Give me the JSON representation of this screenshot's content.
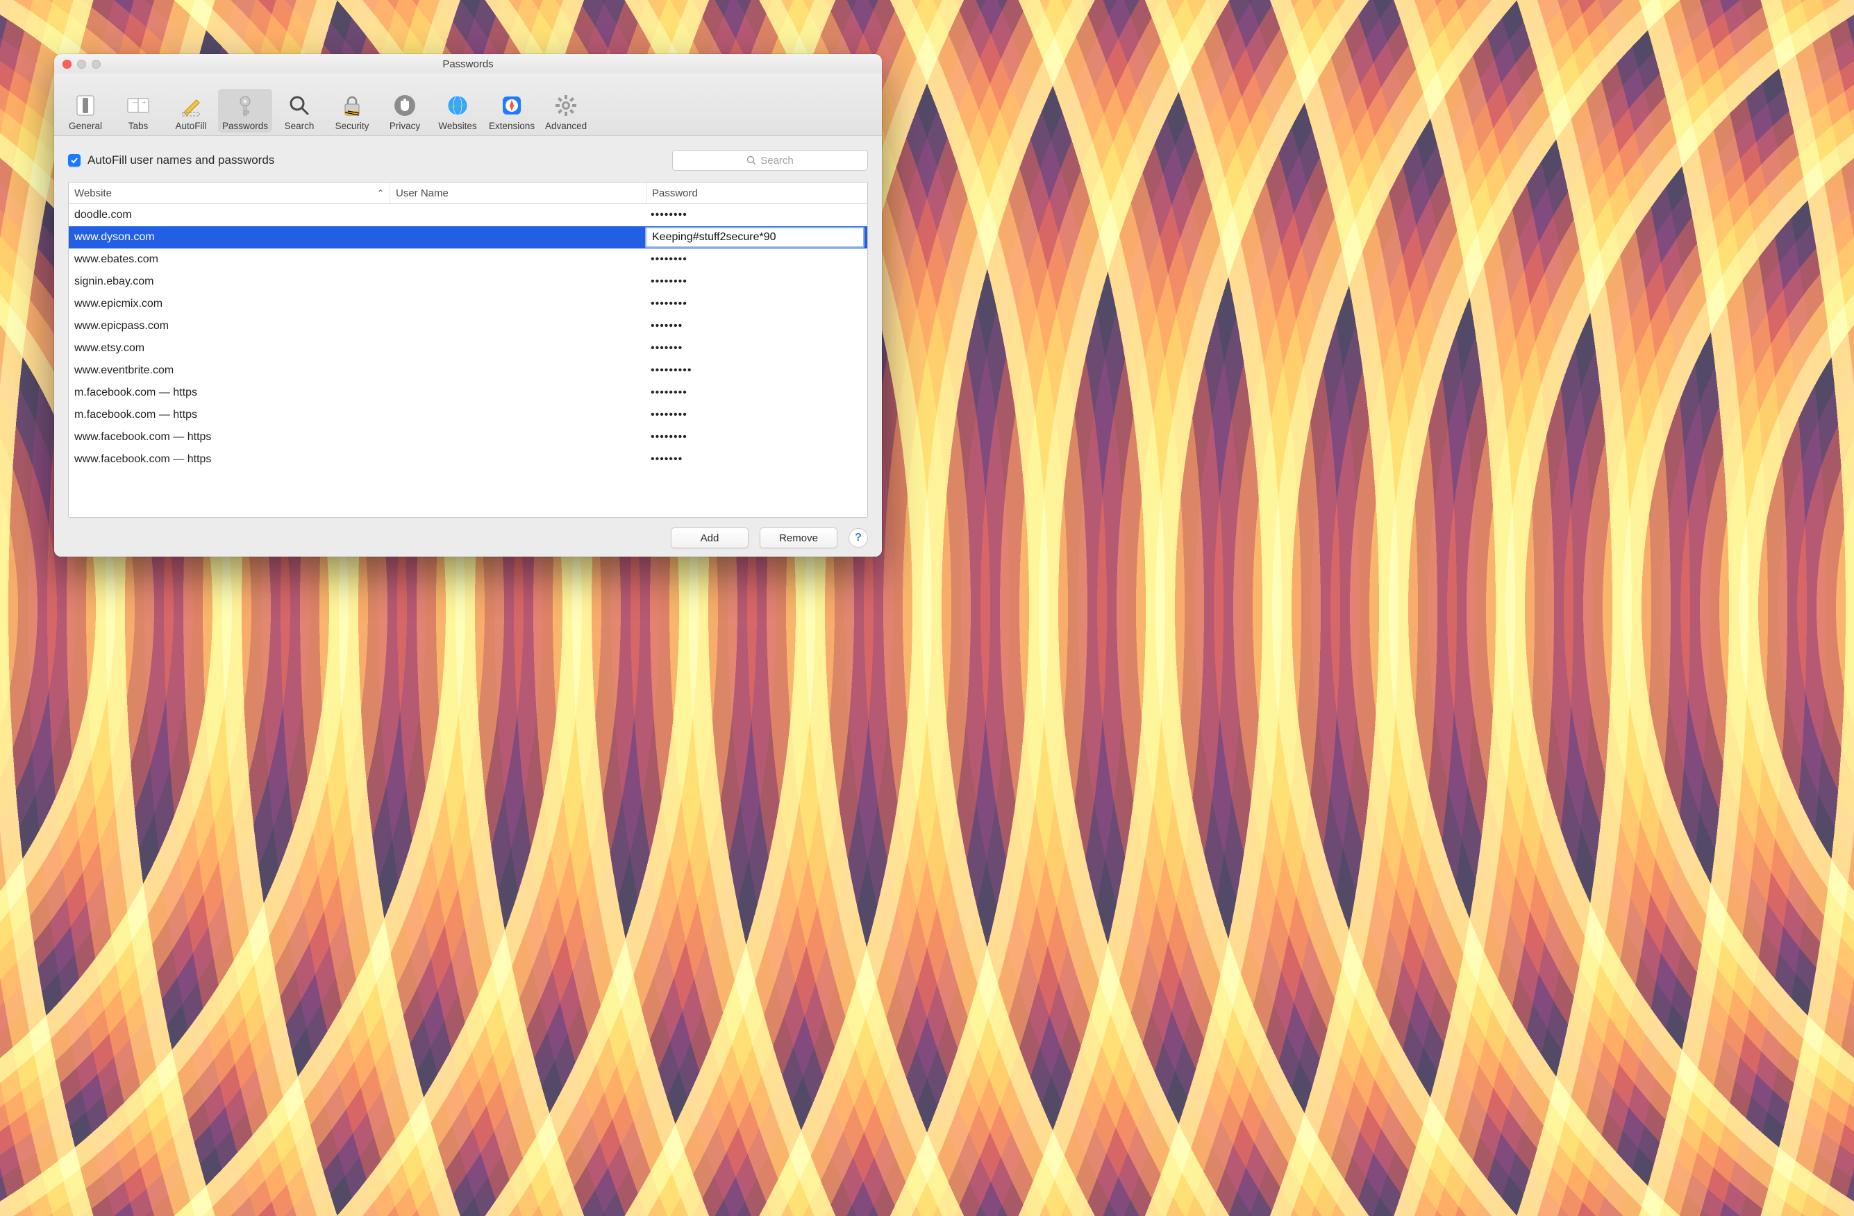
{
  "window": {
    "title": "Passwords"
  },
  "toolbar": {
    "items": [
      {
        "label": "General"
      },
      {
        "label": "Tabs"
      },
      {
        "label": "AutoFill"
      },
      {
        "label": "Passwords"
      },
      {
        "label": "Search"
      },
      {
        "label": "Security"
      },
      {
        "label": "Privacy"
      },
      {
        "label": "Websites"
      },
      {
        "label": "Extensions"
      },
      {
        "label": "Advanced"
      }
    ],
    "active_index": 3
  },
  "autofill_checkbox": {
    "label": "AutoFill user names and passwords",
    "checked": true
  },
  "search": {
    "placeholder": "Search",
    "value": ""
  },
  "columns": {
    "website": "Website",
    "username": "User Name",
    "password": "Password"
  },
  "rows": [
    {
      "website": "doodle.com",
      "username": "",
      "password": "••••••••",
      "selected": false
    },
    {
      "website": "www.dyson.com",
      "username": "",
      "password": "Keeping#stuff2secure*90",
      "selected": true
    },
    {
      "website": "www.ebates.com",
      "username": "",
      "password": "••••••••",
      "selected": false
    },
    {
      "website": "signin.ebay.com",
      "username": "",
      "password": "••••••••",
      "selected": false
    },
    {
      "website": "www.epicmix.com",
      "username": "",
      "password": "••••••••",
      "selected": false
    },
    {
      "website": "www.epicpass.com",
      "username": "",
      "password": "•••••••",
      "selected": false
    },
    {
      "website": "www.etsy.com",
      "username": "",
      "password": "•••••••",
      "selected": false
    },
    {
      "website": "www.eventbrite.com",
      "username": "",
      "password": "•••••••••",
      "selected": false
    },
    {
      "website": "m.facebook.com — https",
      "username": "",
      "password": "••••••••",
      "selected": false
    },
    {
      "website": "m.facebook.com — https",
      "username": "",
      "password": "••••••••",
      "selected": false
    },
    {
      "website": "www.facebook.com — https",
      "username": "",
      "password": "••••••••",
      "selected": false
    },
    {
      "website": "www.facebook.com — https",
      "username": "",
      "password": "•••••••",
      "selected": false
    }
  ],
  "footer": {
    "add": "Add",
    "remove": "Remove",
    "help": "?"
  }
}
